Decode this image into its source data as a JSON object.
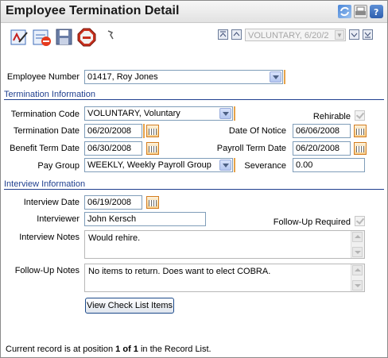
{
  "window": {
    "title": "Employee Termination Detail"
  },
  "toolbar": {
    "record_nav_value": "VOLUNTARY, 6/20/2",
    "icons": [
      "edit-record-icon",
      "new-record-icon",
      "save-icon",
      "stop-icon",
      "pin-icon"
    ],
    "title_icons": [
      "refresh-icon",
      "print-icon",
      "help-icon"
    ]
  },
  "employee": {
    "label": "Employee Number",
    "value": "01417, Roy Jones"
  },
  "termination": {
    "section": "Termination Information",
    "code_label": "Termination Code",
    "code_value": "VOLUNTARY, Voluntary",
    "rehirable_label": "Rehirable",
    "date_label": "Termination Date",
    "date_value": "06/20/2008",
    "notice_label": "Date Of Notice",
    "notice_value": "06/06/2008",
    "benefit_label": "Benefit Term Date",
    "benefit_value": "06/30/2008",
    "payroll_label": "Payroll Term Date",
    "payroll_value": "06/20/2008",
    "paygroup_label": "Pay Group",
    "paygroup_value": "WEEKLY, Weekly Payroll Group",
    "severance_label": "Severance",
    "severance_value": "0.00"
  },
  "interview": {
    "section": "Interview Information",
    "date_label": "Interview Date",
    "date_value": "06/19/2008",
    "interviewer_label": "Interviewer",
    "interviewer_value": "John Kersch",
    "followup_req_label": "Follow-Up Required",
    "notes_label": "Interview Notes",
    "notes_value": "Would rehire.",
    "followup_notes_label": "Follow-Up Notes",
    "followup_notes_value": "No items to return.  Does want to elect COBRA."
  },
  "checklist_button": "View Check List Items",
  "status": {
    "prefix": "Current record is at position ",
    "position": "1 of 1",
    "suffix": " in the Record List."
  },
  "colors": {
    "section_blue": "#1f3f8f",
    "required_marker": "#e7a34a",
    "calendar_orange": "#d47d20"
  }
}
